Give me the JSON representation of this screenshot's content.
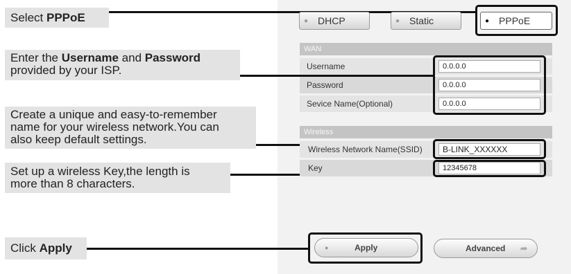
{
  "instructions": {
    "select": {
      "prefix": "Select ",
      "bold": "PPPoE"
    },
    "credentials": {
      "t1": "Enter the ",
      "b1": "Username",
      "t2": " and ",
      "b2": "Password",
      "line2": "provided by your ISP."
    },
    "ssid": {
      "line1": "Create a unique and easy-to-remember",
      "line2": "name for your wireless network.You can",
      "line3": "also keep default settings."
    },
    "key": {
      "line1": "Set up a wireless Key,the length is",
      "line2": "more than 8 characters."
    },
    "apply": {
      "prefix": "Click ",
      "bold": "Apply"
    }
  },
  "router_ui": {
    "modes": [
      {
        "label": "DHCP",
        "selected": false
      },
      {
        "label": "Static",
        "selected": false
      },
      {
        "label": "PPPoE",
        "selected": true
      }
    ],
    "wan": {
      "header": "WAN",
      "rows": [
        {
          "label": "Username",
          "value": "0.0.0.0"
        },
        {
          "label": "Password",
          "value": "0.0.0.0"
        },
        {
          "label": "Sevice Name(Optional)",
          "value": "0.0.0.0"
        }
      ]
    },
    "wireless": {
      "header": "Wireless",
      "rows": [
        {
          "label": "Wireless Network Name(SSID)",
          "value": "B-LINK_XXXXXX"
        },
        {
          "label": "Key",
          "value": "12345678"
        }
      ]
    },
    "buttons": {
      "apply": "Apply",
      "advanced": "Advanced"
    }
  },
  "icons": {
    "radio": "radio-dot-icon",
    "arrow": "arrow-right-icon"
  }
}
